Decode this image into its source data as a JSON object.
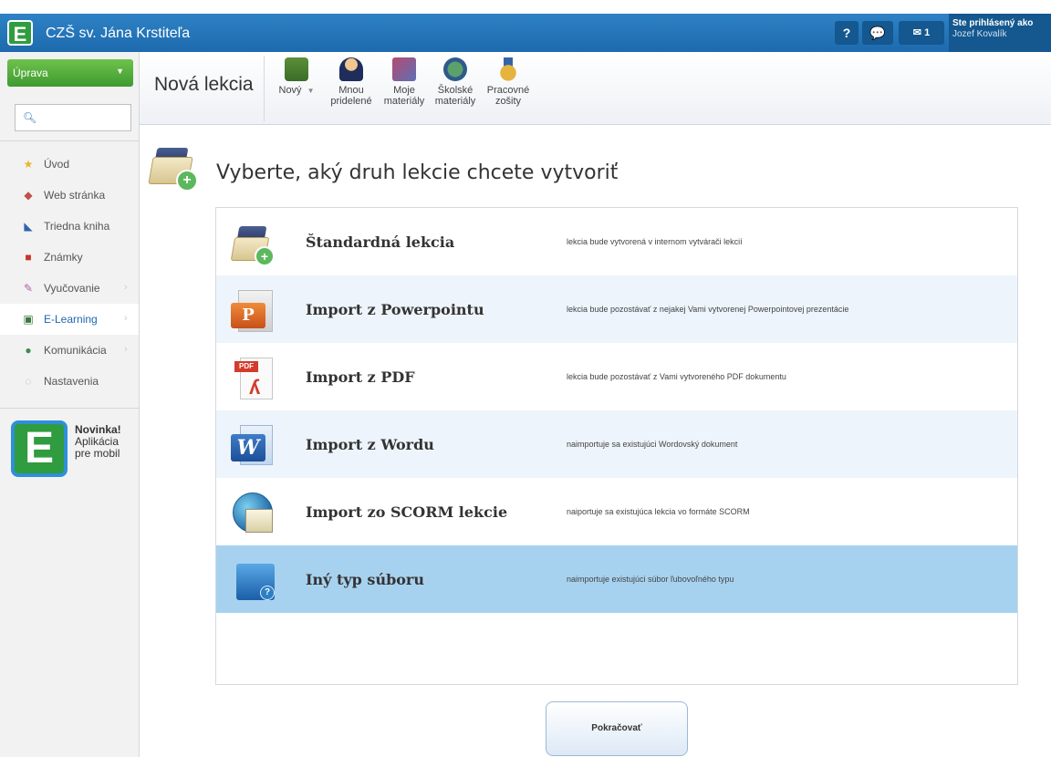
{
  "app": {
    "logo_letter": "E",
    "school_name": "CZŠ sv. Jána Krstiteľa",
    "help_label": "?",
    "mail_count": "1",
    "login_label": "Ste prihlásený ako",
    "login_user": "Jozef Kovalík"
  },
  "sidebar": {
    "edit_label": "Úprava",
    "search": {
      "value": "",
      "placeholder": ""
    },
    "items": [
      {
        "label": "Úvod",
        "icon": "star-icon"
      },
      {
        "label": "Web stránka",
        "icon": "web-icon"
      },
      {
        "label": "Triedna kniha",
        "icon": "book-icon"
      },
      {
        "label": "Známky",
        "icon": "grades-icon"
      },
      {
        "label": "Vyučovanie",
        "icon": "teaching-icon"
      },
      {
        "label": "E-Learning",
        "icon": "elearning-icon",
        "active": true
      },
      {
        "label": "Komunikácia",
        "icon": "communication-icon"
      },
      {
        "label": "Nastavenia",
        "icon": "settings-icon"
      }
    ],
    "promo": {
      "title": "Novinka!",
      "line1": "Aplikácia",
      "line2": "pre mobil"
    }
  },
  "toolbar": {
    "title": "Nová lekcia",
    "tools": [
      {
        "label": "Nový"
      },
      {
        "label_l1": "Mnou",
        "label_l2": "pridelené"
      },
      {
        "label_l1": "Moje",
        "label_l2": "materiály"
      },
      {
        "label_l1": "Školské",
        "label_l2": "materiály"
      },
      {
        "label_l1": "Pracovné",
        "label_l2": "zošity"
      }
    ]
  },
  "main": {
    "heading": "Vyberte, aký druh lekcie chcete vytvoriť",
    "options": [
      {
        "title": "Štandardná lekcia",
        "desc": "lekcia bude vytvorená v internom vytvárači lekcií",
        "icon": "standard-lesson-icon"
      },
      {
        "title": "Import z Powerpointu",
        "desc": "lekcia bude pozostávať z nejakej Vami vytvorenej Powerpointovej prezentácie",
        "icon": "powerpoint-icon"
      },
      {
        "title": "Import z PDF",
        "desc": "lekcia bude pozostávať z Vami vytvoreného PDF dokumentu",
        "icon": "pdf-icon"
      },
      {
        "title": "Import z Wordu",
        "desc": "naimportuje sa existujúci Wordovský dokument",
        "icon": "word-icon"
      },
      {
        "title": "Import zo SCORM lekcie",
        "desc": "naiportuje sa existujúca lekcia vo formáte SCORM",
        "icon": "scorm-icon"
      },
      {
        "title": "Iný typ súboru",
        "desc": "naimportuje existujúci súbor ľubovoľného typu",
        "icon": "other-file-icon",
        "selected": true
      }
    ],
    "continue_label": "Pokračovať"
  },
  "colors": {
    "topbar": "#1d6aae",
    "edit_button": "#4ea638",
    "selected_row": "#a7d2ef",
    "alt_row": "#eef4fb"
  }
}
